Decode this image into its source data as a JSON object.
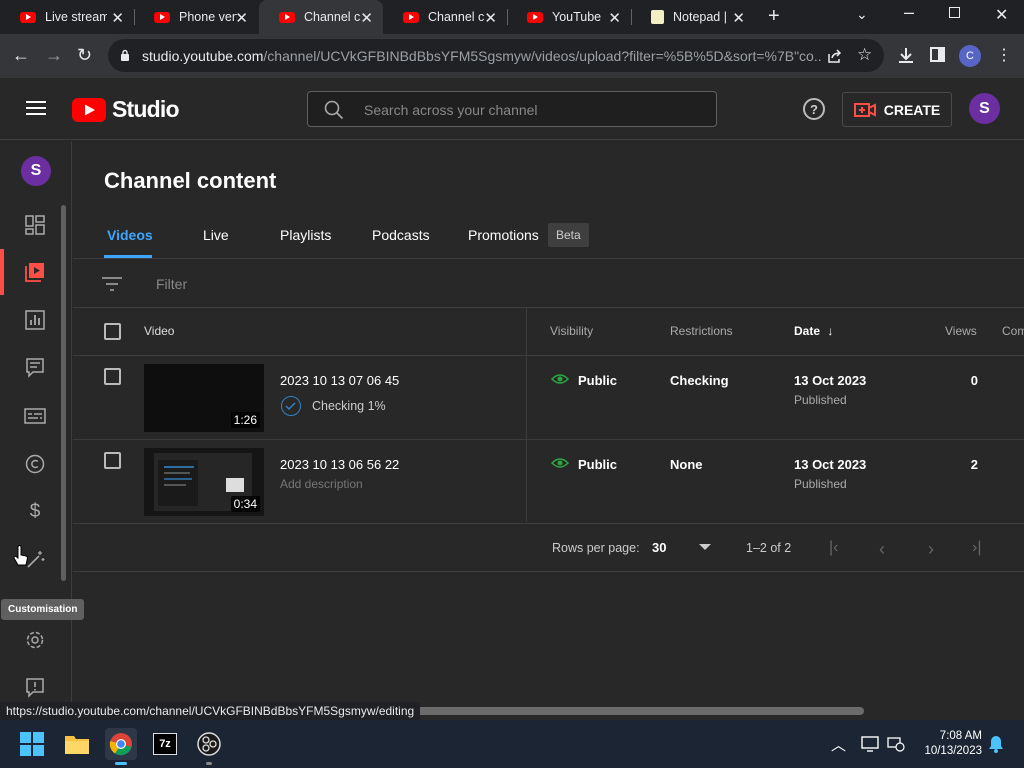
{
  "browser": {
    "tabs": [
      {
        "title": "Live stream",
        "icon": "youtube-icon"
      },
      {
        "title": "Phone vert",
        "icon": "youtube-icon"
      },
      {
        "title": "Channel c",
        "icon": "youtube-icon"
      },
      {
        "title": "Channel c",
        "icon": "youtube-icon"
      },
      {
        "title": "YouTube",
        "icon": "youtube-icon"
      },
      {
        "title": "Notepad |",
        "icon": "notepad-icon"
      }
    ],
    "url_host": "studio.youtube.com",
    "url_path": "/channel/UCVkGFBINBdBbsYFM5Sgsmyw/videos/upload?filter=%5B%5D&sort=%7B\"co...",
    "profile_initial": "C"
  },
  "header": {
    "logo_text": "Studio",
    "search_placeholder": "Search across your channel",
    "create_label": "CREATE",
    "avatar_initial": "S"
  },
  "sidebar": {
    "avatar_initial": "S",
    "tooltip": "Customisation",
    "items": [
      "dashboard-icon",
      "content-icon",
      "analytics-icon",
      "comments-icon",
      "subtitles-icon",
      "copyright-icon",
      "earn-icon",
      "customisation-icon",
      "settings-icon",
      "feedback-icon"
    ]
  },
  "main": {
    "title": "Channel content",
    "tabs": [
      "Videos",
      "Live",
      "Playlists",
      "Podcasts",
      "Promotions"
    ],
    "beta_label": "Beta",
    "filter_placeholder": "Filter",
    "columns": {
      "video": "Video",
      "visibility": "Visibility",
      "restrictions": "Restrictions",
      "date": "Date",
      "views": "Views",
      "comments": "Com"
    },
    "rows": [
      {
        "title": "2023 10 13 07 06 45",
        "duration": "1:26",
        "sub": "Checking 1%",
        "visibility": "Public",
        "restrictions": "Checking",
        "date": "13 Oct 2023",
        "date_status": "Published",
        "views": "0"
      },
      {
        "title": "2023 10 13 06 56 22",
        "duration": "0:34",
        "sub": "Add description",
        "visibility": "Public",
        "restrictions": "None",
        "date": "13 Oct 2023",
        "date_status": "Published",
        "views": "2"
      }
    ],
    "pagination": {
      "rows_label": "Rows per page:",
      "rows_value": "30",
      "range": "1–2 of 2"
    }
  },
  "status_url": "https://studio.youtube.com/channel/UCVkGFBINBdBbsYFM5Sgsmyw/editing",
  "taskbar": {
    "time": "7:08 AM",
    "date": "10/13/2023"
  },
  "colors": {
    "accent": "#3ea6ff",
    "red": "#ff0000",
    "public_green": "#2ba640"
  }
}
